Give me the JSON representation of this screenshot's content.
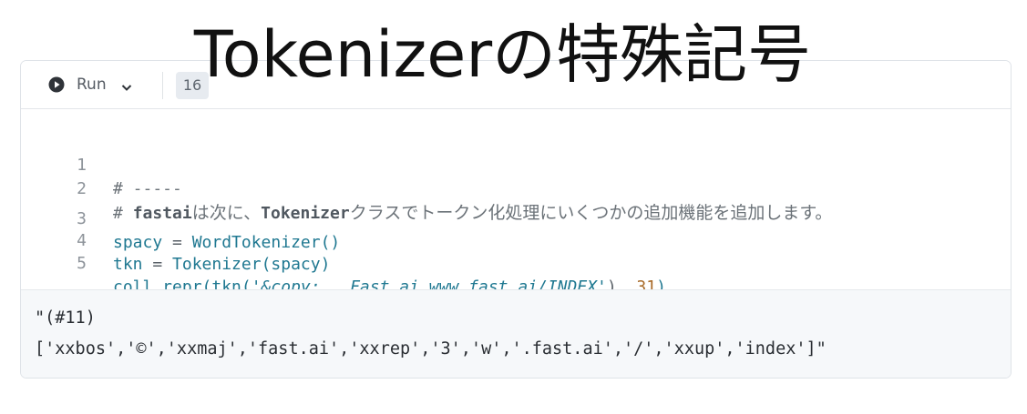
{
  "title": "Tokenizerの特殊記号",
  "toolbar": {
    "run_label": "Run",
    "execution_count": "16"
  },
  "code": {
    "lines": [
      {
        "num": "1",
        "comment": "# -----"
      },
      {
        "num": "2",
        "comment_prefix": "# ",
        "comment_bold1": "fastai",
        "comment_text1": "は次に、",
        "comment_bold2": "Tokenizer",
        "comment_text2": "クラスでトークン化処理にいくつかの追加機能を追加します。"
      },
      {
        "num": "3",
        "var": "spacy",
        "op": " = ",
        "call": "WordTokenizer()"
      },
      {
        "num": "4",
        "var": "tkn",
        "op": " = ",
        "call": "Tokenizer(",
        "arg": "spacy",
        "close": ")"
      },
      {
        "num": "5",
        "func": "coll_repr(tkn(",
        "str": "'&copy;   Fast.ai www.fast.ai/INDEX'",
        "mid": "), ",
        "num_arg": "31",
        "close": ")"
      }
    ]
  },
  "output": {
    "line1": "\"(#11)",
    "line2": "['xxbos','©','xxmaj','fast.ai','xxrep','3','w','.fast.ai','/','xxup','index']\""
  },
  "colors": {
    "accent": "#1f7891",
    "number": "#a86a28",
    "comment": "#6b7278",
    "output_bg": "#f6f8fa"
  }
}
